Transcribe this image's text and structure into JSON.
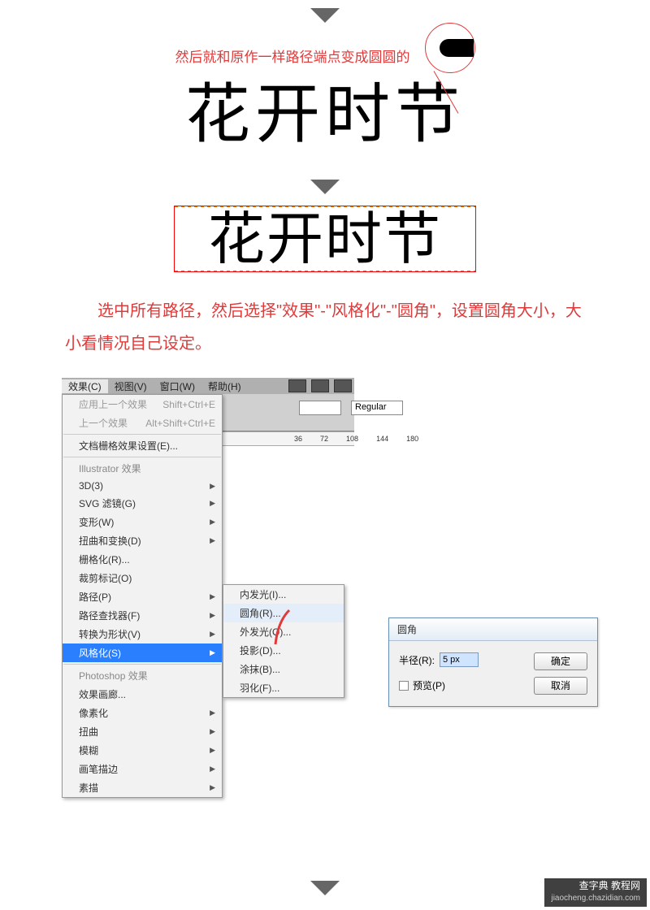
{
  "caption1": "然后就和原作一样路径端点变成圆圆的",
  "sample_text": "花开时节",
  "body_text": "选中所有路径，然后选择\"效果\"-\"风格化\"-\"圆角\"，设置圆角大小，大小看情况自己设定。",
  "menubar": {
    "items": [
      "效果(C)",
      "视图(V)",
      "窗口(W)",
      "帮助(H)"
    ],
    "dd1": "",
    "dd2": "Regular",
    "ruler": [
      "36",
      "72",
      "108",
      "144",
      "180"
    ]
  },
  "menu": {
    "apply_last": "应用上一个效果",
    "apply_last_sc": "Shift+Ctrl+E",
    "last": "上一个效果",
    "last_sc": "Alt+Shift+Ctrl+E",
    "doc_raster": "文档栅格效果设置(E)...",
    "ai_header": "Illustrator 效果",
    "ai_items": [
      "3D(3)",
      "SVG 滤镜(G)",
      "变形(W)",
      "扭曲和变换(D)",
      "栅格化(R)...",
      "裁剪标记(O)",
      "路径(P)",
      "路径查找器(F)",
      "转换为形状(V)",
      "风格化(S)"
    ],
    "ps_header": "Photoshop 效果",
    "ps_items": [
      "效果画廊...",
      "像素化",
      "扭曲",
      "模糊",
      "画笔描边",
      "素描"
    ]
  },
  "submenu": {
    "items": [
      "内发光(I)...",
      "圆角(R)...",
      "外发光(O)...",
      "投影(D)...",
      "涂抹(B)...",
      "羽化(F)..."
    ]
  },
  "dialog": {
    "title": "圆角",
    "radius_label": "半径(R):",
    "radius_value": "5 px",
    "preview_label": "预览(P)",
    "ok": "确定",
    "cancel": "取消"
  },
  "watermark": {
    "line1": "查字典 教程网",
    "line2": "jiaocheng.chazidian.com"
  }
}
